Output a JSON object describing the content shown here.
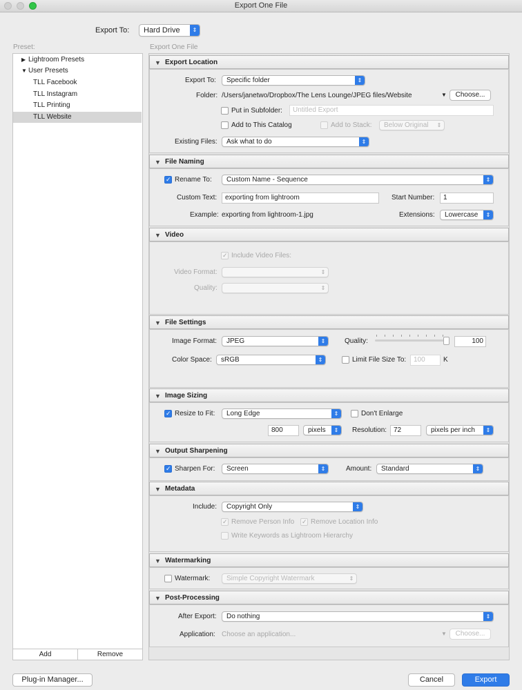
{
  "window": {
    "title": "Export One File"
  },
  "top": {
    "export_to_label": "Export To:",
    "export_to_value": "Hard Drive"
  },
  "sidebar": {
    "preset_label": "Preset:",
    "items": [
      {
        "label": "Lightroom Presets",
        "expanded": false
      },
      {
        "label": "User Presets",
        "expanded": true
      },
      {
        "label": "TLL Facebook"
      },
      {
        "label": "TLL Instagram"
      },
      {
        "label": "TLL Printing"
      },
      {
        "label": "TLL Website",
        "selected": true
      }
    ],
    "add_label": "Add",
    "remove_label": "Remove"
  },
  "main": {
    "header_label": "Export One File"
  },
  "sections": {
    "export_location": {
      "title": "Export Location",
      "export_to_label": "Export To:",
      "export_to_value": "Specific folder",
      "folder_label": "Folder:",
      "folder_value": "/Users/janetwo/Dropbox/The Lens Lounge/JPEG files/Website",
      "choose_label": "Choose...",
      "subfolder_label": "Put in Subfolder:",
      "subfolder_placeholder": "Untitled Export",
      "add_catalog_label": "Add to This Catalog",
      "add_stack_label": "Add to Stack:",
      "stack_value": "Below Original",
      "existing_label": "Existing Files:",
      "existing_value": "Ask what to do"
    },
    "file_naming": {
      "title": "File Naming",
      "rename_label": "Rename To:",
      "rename_value": "Custom Name - Sequence",
      "custom_text_label": "Custom Text:",
      "custom_text_value": "exporting from lightroom",
      "start_number_label": "Start Number:",
      "start_number_value": "1",
      "example_label": "Example:",
      "example_value": "exporting from lightroom-1.jpg",
      "extensions_label": "Extensions:",
      "extensions_value": "Lowercase"
    },
    "video": {
      "title": "Video",
      "include_label": "Include Video Files:",
      "format_label": "Video Format:",
      "quality_label": "Quality:"
    },
    "file_settings": {
      "title": "File Settings",
      "format_label": "Image Format:",
      "format_value": "JPEG",
      "quality_label": "Quality:",
      "quality_value": "100",
      "quality_fraction": 1.0,
      "colorspace_label": "Color Space:",
      "colorspace_value": "sRGB",
      "limit_label": "Limit File Size To:",
      "limit_value": "100",
      "limit_unit": "K"
    },
    "image_sizing": {
      "title": "Image Sizing",
      "resize_label": "Resize to Fit:",
      "resize_value": "Long Edge",
      "dont_enlarge_label": "Don't Enlarge",
      "size_value": "800",
      "size_unit": "pixels",
      "resolution_label": "Resolution:",
      "resolution_value": "72",
      "resolution_unit": "pixels per inch"
    },
    "output_sharpening": {
      "title": "Output Sharpening",
      "sharpen_label": "Sharpen For:",
      "sharpen_value": "Screen",
      "amount_label": "Amount:",
      "amount_value": "Standard"
    },
    "metadata": {
      "title": "Metadata",
      "include_label": "Include:",
      "include_value": "Copyright Only",
      "remove_person_label": "Remove Person Info",
      "remove_location_label": "Remove Location Info",
      "keywords_label": "Write Keywords as Lightroom Hierarchy"
    },
    "watermarking": {
      "title": "Watermarking",
      "watermark_label": "Watermark:",
      "watermark_value": "Simple Copyright Watermark"
    },
    "post_processing": {
      "title": "Post-Processing",
      "after_label": "After Export:",
      "after_value": "Do nothing",
      "application_label": "Application:",
      "application_placeholder": "Choose an application...",
      "choose_label": "Choose..."
    }
  },
  "footer": {
    "plugin_label": "Plug-in Manager...",
    "cancel_label": "Cancel",
    "export_label": "Export"
  },
  "colors": {
    "accent": "#2f7ce8",
    "window_bg": "#ececec",
    "traffic_green": "#32c648"
  }
}
